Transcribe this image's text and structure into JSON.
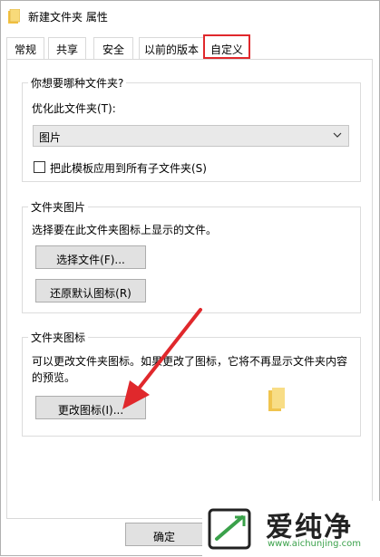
{
  "window": {
    "title": "新建文件夹 属性"
  },
  "tabs": [
    {
      "label": "常规"
    },
    {
      "label": "共享"
    },
    {
      "label": "安全"
    },
    {
      "label": "以前的版本"
    },
    {
      "label": "自定义"
    }
  ],
  "optimize_group": {
    "title": "你想要哪种文件夹?",
    "label": "优化此文件夹(T):",
    "selected": "图片",
    "checkbox_label": "把此模板应用到所有子文件夹(S)",
    "checkbox_checked": false
  },
  "picture_group": {
    "title": "文件夹图片",
    "description": "选择要在此文件夹图标上显示的文件。",
    "choose_button": "选择文件(F)...",
    "restore_button": "还原默认图标(R)"
  },
  "icon_group": {
    "title": "文件夹图标",
    "description_line1": "可以更改文件夹图标。如果更改了图标，它将不再显示文件夹内容",
    "description_line2": "的预览。",
    "change_button": "更改图标(I)..."
  },
  "footer": {
    "ok_button": "确定"
  },
  "watermark": {
    "text": "爱纯净",
    "url": "www.aichunjing.com"
  },
  "colors": {
    "highlight": "#e0282c",
    "folder": "#f5d36b",
    "watermark_green": "#3aa14a"
  }
}
